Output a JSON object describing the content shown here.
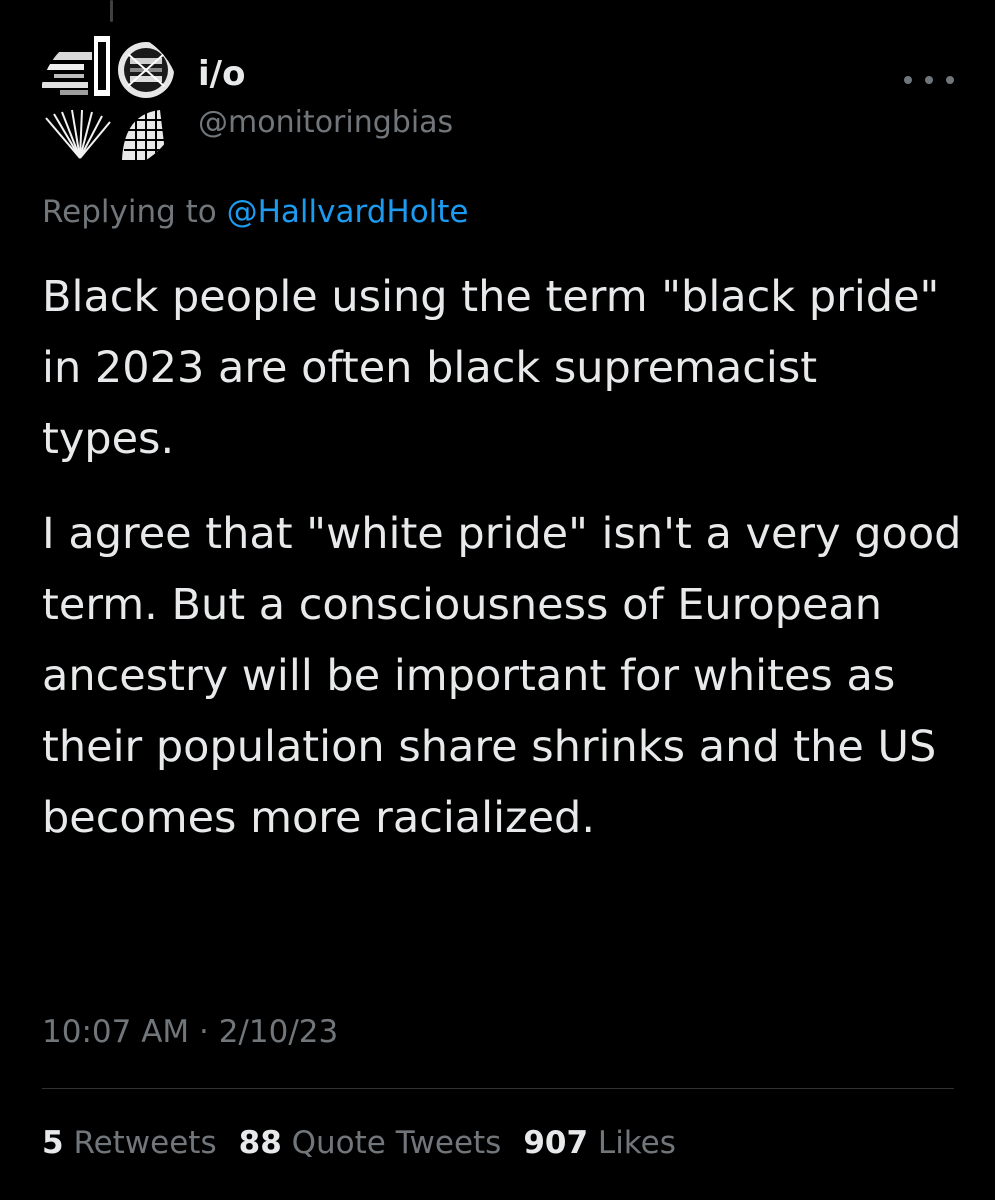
{
  "colors": {
    "background": "#000000",
    "text_primary": "#e7e9ea",
    "text_secondary": "#71767b",
    "link": "#1d9bf0",
    "divider": "#2f3336"
  },
  "author": {
    "display_name": "i/o",
    "handle": "@monitoringbias",
    "avatar_icon": "abstract-monochrome-avatar"
  },
  "more_icon": "more-horizontal-icon",
  "reply_context": {
    "prefix": "Replying to ",
    "mention": "@HallvardHolte"
  },
  "tweet": {
    "paragraphs": [
      "Black people using the term \"black pride\" in 2023 are often black supremacist types.",
      "I agree that \"white pride\" isn't a very good term. But a consciousness of European ancestry will be important for whites as their population share shrinks and the US becomes more racialized."
    ],
    "timestamp": "10:07 AM · 2/10/23"
  },
  "stats": {
    "retweets": {
      "count": "5",
      "label": "Retweets"
    },
    "quotes": {
      "count": "88",
      "label": "Quote Tweets"
    },
    "likes": {
      "count": "907",
      "label": "Likes"
    }
  }
}
